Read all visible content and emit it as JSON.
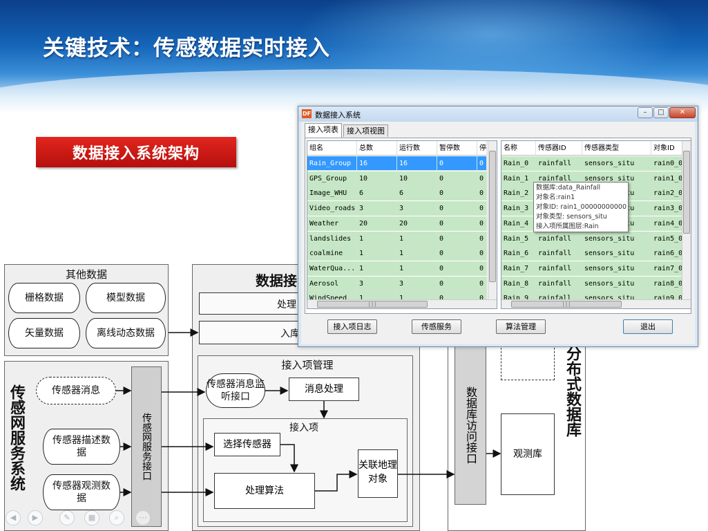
{
  "slide": {
    "title": "关键技术：传感数据实时接入",
    "subtitle_button": "数据接入系统架构"
  },
  "diagram": {
    "other_data": {
      "title": "其他数据",
      "items": [
        "栅格数据",
        "模型数据",
        "矢量数据",
        "离线动态数据"
      ]
    },
    "sensor_web": {
      "title": "传感网服务系统",
      "items": [
        "传感器消息",
        "传感器描述数据",
        "传感器观测数据"
      ],
      "interface": "传感网服务接口"
    },
    "access_panel": {
      "title": "数据接",
      "processing": "处理",
      "storage": "入库"
    },
    "access_mgmt": {
      "title": "接入项管理",
      "listener": "传感器消息监听接口",
      "msg_proc": "消息处理",
      "item_title": "接入项",
      "select_sensor": "选择传感器",
      "process_algo": "处理算法",
      "link_object": "关联地理对象"
    },
    "db": {
      "access_interface": "数据库访问接口",
      "obs_db": "观测库",
      "dist_db": "分布式数据库"
    }
  },
  "window": {
    "title": "数据接入系统",
    "icon_text": "DF",
    "tabs": [
      "接入项表",
      "接入项视图"
    ],
    "left_grid": {
      "columns": [
        "组名",
        "总数",
        "运行数",
        "暂停数",
        "停"
      ],
      "rows": [
        [
          "Rain_Group",
          "16",
          "16",
          "0",
          "0"
        ],
        [
          "GPS_Group",
          "10",
          "10",
          "0",
          "0"
        ],
        [
          "Image_WHU",
          "6",
          "6",
          "0",
          "0"
        ],
        [
          "Video_roads",
          "3",
          "3",
          "0",
          "0"
        ],
        [
          "Weather",
          "20",
          "20",
          "0",
          "0"
        ],
        [
          "landslides",
          "1",
          "1",
          "0",
          "0"
        ],
        [
          "coalmine",
          "1",
          "1",
          "0",
          "0"
        ],
        [
          "WaterQua...",
          "1",
          "1",
          "0",
          "0"
        ],
        [
          "Aerosol",
          "3",
          "3",
          "0",
          "0"
        ],
        [
          "WindSpeed",
          "1",
          "1",
          "0",
          "0"
        ]
      ]
    },
    "right_grid": {
      "columns": [
        "名称",
        "传感器ID",
        "传感器类型",
        "对象ID"
      ],
      "rows": [
        [
          "Rain_0",
          "rainfall",
          "sensors_situ",
          "rain0_0"
        ],
        [
          "Rain_1",
          "rainfall",
          "sensors_situ",
          "rain1_0"
        ],
        [
          "Rain_2",
          "rainfall",
          "sensors_situ",
          "rain2_0"
        ],
        [
          "Rain_3",
          "rainfall",
          "sensors_situ",
          "rain3_0"
        ],
        [
          "Rain_4",
          "rainfall",
          "sensors_situ",
          "rain4_0"
        ],
        [
          "Rain_5",
          "rainfall",
          "sensors_situ",
          "rain5_0"
        ],
        [
          "Rain_6",
          "rainfall",
          "sensors_situ",
          "rain6_0"
        ],
        [
          "Rain_7",
          "rainfall",
          "sensors_situ",
          "rain7_0"
        ],
        [
          "Rain_8",
          "rainfall",
          "sensors_situ",
          "rain8_0"
        ],
        [
          "Rain_9",
          "rainfall",
          "sensors_situ",
          "rain9_0"
        ]
      ]
    },
    "tooltip": [
      "数据库:data_Rainfall",
      "对象名:rain1",
      "对象ID: rain1_00000000000",
      "对象类型: sensors_situ",
      "接入项所属图层:Rain"
    ],
    "buttons": {
      "log": "接入项日志",
      "sensor_service": "传感服务",
      "algorithm": "算法管理",
      "exit": "退出"
    }
  }
}
